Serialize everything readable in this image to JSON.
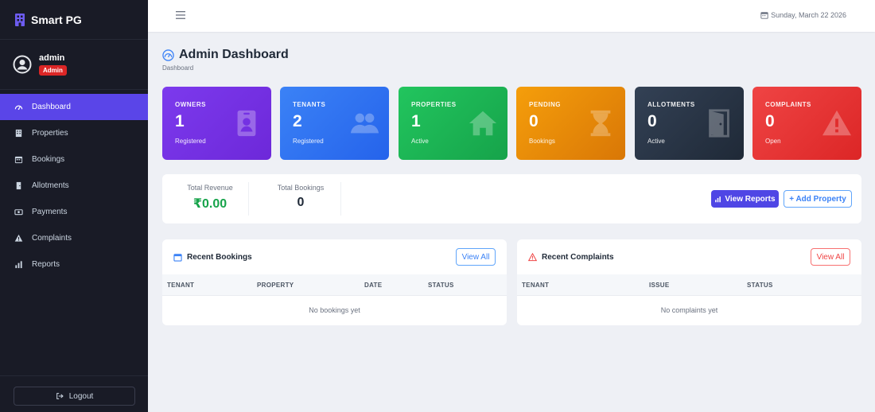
{
  "app": {
    "brand": "Smart PG"
  },
  "user": {
    "name": "admin",
    "role": "Admin"
  },
  "sidebar": {
    "items": [
      {
        "label": "Dashboard",
        "icon": "gauge-icon",
        "active": true
      },
      {
        "label": "Properties",
        "icon": "building-icon"
      },
      {
        "label": "Bookings",
        "icon": "calendar-icon"
      },
      {
        "label": "Allotments",
        "icon": "door-icon"
      },
      {
        "label": "Payments",
        "icon": "money-icon"
      },
      {
        "label": "Complaints",
        "icon": "warning-icon"
      },
      {
        "label": "Reports",
        "icon": "bar-chart-icon"
      }
    ],
    "logout": "Logout"
  },
  "topbar": {
    "date": "Sunday, March 22 2026"
  },
  "page": {
    "title": "Admin Dashboard",
    "breadcrumb": "Dashboard"
  },
  "stats": [
    {
      "label": "Owners",
      "value": "1",
      "sub": "Registered",
      "icon": "id-badge-icon",
      "color": "#7c3aed"
    },
    {
      "label": "Tenants",
      "value": "2",
      "sub": "Registered",
      "icon": "users-icon",
      "color": "#2563eb"
    },
    {
      "label": "Properties",
      "value": "1",
      "sub": "Active",
      "icon": "home-icon",
      "color": "#16a34a"
    },
    {
      "label": "Pending",
      "value": "0",
      "sub": "Bookings",
      "icon": "hourglass-icon",
      "color": "#e08a0b"
    },
    {
      "label": "Allotments",
      "value": "0",
      "sub": "Active",
      "icon": "door-open-icon",
      "color": "#273142"
    },
    {
      "label": "Complaints",
      "value": "0",
      "sub": "Open",
      "icon": "warning-icon",
      "color": "#dc2434"
    }
  ],
  "summary": {
    "revenue_label": "Total Revenue",
    "revenue_value": "₹0.00",
    "bookings_label": "Total Bookings",
    "bookings_value": "0",
    "view_reports": "View Reports",
    "add_property": "+ Add Property"
  },
  "recent_bookings": {
    "title": "Recent Bookings",
    "view_all": "View All",
    "columns": [
      "TENANT",
      "PROPERTY",
      "DATE",
      "STATUS"
    ],
    "empty": "No bookings yet"
  },
  "recent_complaints": {
    "title": "Recent Complaints",
    "view_all": "View All",
    "columns": [
      "TENANT",
      "ISSUE",
      "STATUS"
    ],
    "empty": "No complaints yet"
  },
  "colors": {
    "accent": "#5a45e8",
    "sidebar_bg": "#191b26",
    "revenue": "#16a34a"
  }
}
